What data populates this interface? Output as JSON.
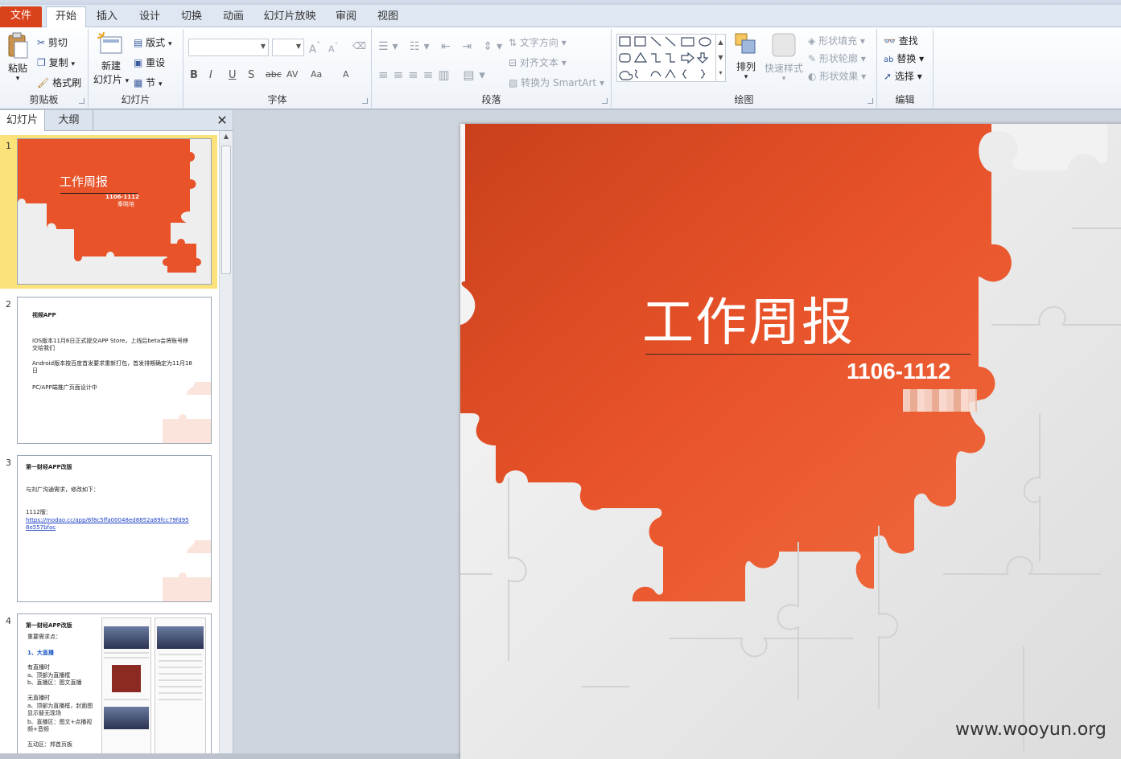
{
  "tabs": [
    "文件",
    "开始",
    "插入",
    "设计",
    "切换",
    "动画",
    "幻灯片放映",
    "审阅",
    "视图"
  ],
  "ribbon": {
    "clipboard": {
      "paste": "粘贴",
      "cut": "剪切",
      "copy": "复制",
      "format_painter": "格式刷",
      "label": "剪贴板"
    },
    "slides": {
      "new_line1": "新建",
      "new_line2": "幻灯片",
      "layout": "版式",
      "reset": "重设",
      "section": "节",
      "label": "幻灯片"
    },
    "font": {
      "label": "字体",
      "buttons": [
        "B",
        "I",
        "U",
        "S",
        "abc",
        "AV",
        "Aa",
        "A"
      ]
    },
    "paragraph": {
      "text_direction": "文字方向",
      "align_text": "对齐文本",
      "convert_smartart": "转换为 SmartArt",
      "label": "段落"
    },
    "drawing": {
      "arrange": "排列",
      "quick_styles": "快速样式",
      "shape_fill": "形状填充",
      "shape_outline": "形状轮廓",
      "shape_effects": "形状效果",
      "label": "绘图"
    },
    "editing": {
      "find": "查找",
      "replace": "替换",
      "select": "选择",
      "label": "编辑"
    }
  },
  "panel": {
    "tab_slides": "幻灯片",
    "tab_outline": "大纲",
    "close": "✕"
  },
  "thumbnails": [
    {
      "num": "1",
      "title": "工作周报",
      "subtitle": "1106-1112",
      "author": "秦晓培"
    },
    {
      "num": "2",
      "heading": "视频APP",
      "lines": [
        "IOS版本11月6日正式提交APP Store，上线后beta会将账号移交给我们",
        "Android版本按百度首发要求重新打包，首发排期确定为11月18日",
        "PC/APP端推广页面设计中"
      ]
    },
    {
      "num": "3",
      "heading": "第一财经APP改版",
      "lines": [
        "与刘广沟通需求，修改如下：",
        "1112版：",
        "https://modao.cc/app/6f8c5ffa00048ed8852a89fcc79fd958e557bfac"
      ]
    },
    {
      "num": "4",
      "heading": "第一财经APP改版",
      "lines": [
        "重要需求点：",
        "1、大直播",
        "有直播时",
        "a、顶部为直播框",
        "b、直播区：图文直播",
        "无直播时",
        "a、顶部为直播框，封面图显示替无现场",
        "b、直播区：图文+点播视频+音频",
        "互动区：邦首页板"
      ]
    }
  ],
  "slide": {
    "title": "工作周报",
    "subtitle": "1106-1112"
  },
  "watermark": "www.wooyun.org",
  "colors": {
    "accent_orange": "#e8532a",
    "file_tab": "#d9421b",
    "selected_thumb": "#fbe27a"
  }
}
